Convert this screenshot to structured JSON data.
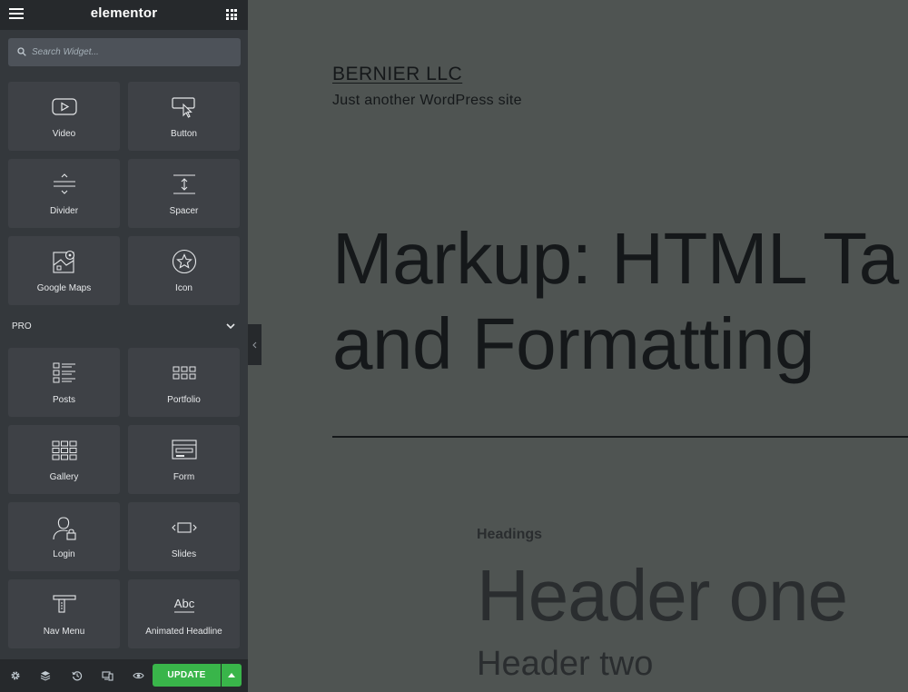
{
  "panel": {
    "logo": "elementor",
    "search": {
      "placeholder": "Search Widget..."
    },
    "widgets_basic": [
      {
        "label": "Video"
      },
      {
        "label": "Button"
      },
      {
        "label": "Divider"
      },
      {
        "label": "Spacer"
      },
      {
        "label": "Google Maps"
      },
      {
        "label": "Icon"
      }
    ],
    "pro_section": {
      "label": "PRO"
    },
    "widgets_pro": [
      {
        "label": "Posts"
      },
      {
        "label": "Portfolio"
      },
      {
        "label": "Gallery"
      },
      {
        "label": "Form"
      },
      {
        "label": "Login"
      },
      {
        "label": "Slides"
      },
      {
        "label": "Nav Menu"
      },
      {
        "label": "Animated Headline"
      }
    ],
    "footer": {
      "update_label": "UPDATE"
    },
    "colors": {
      "update": "#39b54a",
      "panel_bg": "#34383c",
      "tile_bg": "#3e4146"
    }
  },
  "preview": {
    "site_title": "BERNIER LLC",
    "tagline": "Just another WordPress site",
    "post_title_line1": "Markup: HTML Ta",
    "post_title_line2": "and Formatting",
    "section_label": "Headings",
    "header_one": "Header one",
    "header_two": "Header two"
  }
}
